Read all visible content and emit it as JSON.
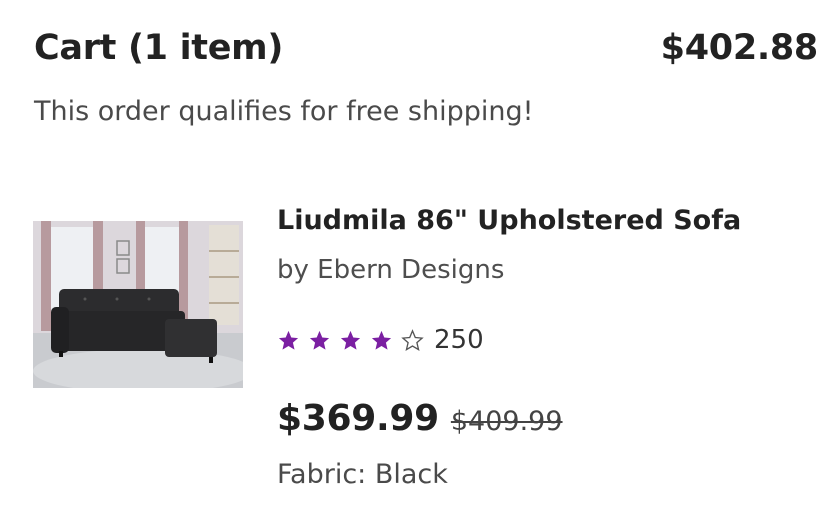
{
  "cart": {
    "title": "Cart (1 item)",
    "total": "$402.88",
    "shipping_message": "This order qualifies for free shipping!"
  },
  "item": {
    "name": "Liudmila 86\" Upholstered Sofa",
    "brand": "by Ebern Designs",
    "rating": 4,
    "rating_max": 5,
    "review_count": "250",
    "price": "$369.99",
    "original_price": "$409.99",
    "variant": "Fabric: Black",
    "image_icon": "sofa-product-image"
  },
  "colors": {
    "star": "#7b1fa2",
    "text": "#222222"
  }
}
